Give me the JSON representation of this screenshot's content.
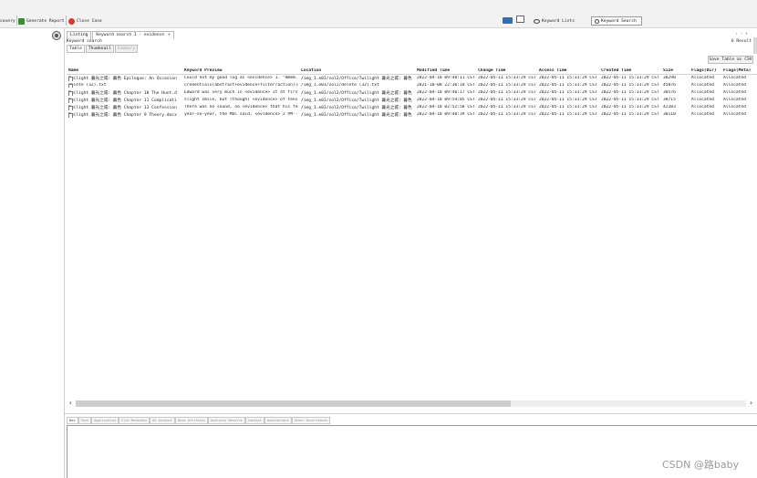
{
  "toolbar": {
    "discovery_label": "covery",
    "generate_report_label": "Generate Report",
    "close_case_label": "Close Case",
    "keyword_lists_label": "Keyword Lists",
    "keyword_search_label": "Keyword Search"
  },
  "results": {
    "tabs": [
      {
        "label": "Listing"
      },
      {
        "label": "Keyword search 1 - evidence",
        "close": "×"
      }
    ],
    "nav_arrows": "‹ › ▾",
    "keyword_label": "Keyword search",
    "result_count": "6 Result",
    "view_tabs": [
      "Table",
      "Thumbnail",
      "Summary"
    ],
    "save_button": "Save Table as CSV",
    "columns": [
      "Name",
      "Keyword Preview",
      "Location",
      "Modified Time",
      "Change Time",
      "Access Time",
      "Created Time",
      "Size",
      "Flags(Dir)",
      "Flags(Meta)"
    ],
    "rows": [
      [
        "Twilight 暮光之城: 暮色 Epilogue: An Occasion",
        "Could not my good log as <evidence> 1. \"Hmmm.\"",
        "/img_1.e01/vol2/Office/Twilight 暮光之城: 暮色",
        "2022-04-18 09:48:11 CST",
        "2022-05-11 15:33:29 CST",
        "2022-05-11 15:33:29 CST",
        "2022-05-11 15:33:29 CST",
        "38290",
        "Allocated",
        "Allocated"
      ],
      [
        "delete (32).txt",
        "credentials(abstract+evidence+filter/action)(mock",
        "/img_1.e01/vol2/delete (32).txt",
        "2021-10-08 22:36:18 CST",
        "2022-05-11 15:33:29 CST",
        "2022-05-11 15:33:29 CST",
        "2022-05-11 15:33:29 CST",
        "45076",
        "Allocated",
        "Allocated"
      ],
      [
        "Twilight 暮光之城: 暮色 Chapter 10 The Hunt.d",
        "Edward was very much in <evidence> It at first",
        "/img_1.e01/vol2/Office/Twilight 暮光之城: 暮色",
        "2022-04-18 09:46:17 CST",
        "2022-05-11 15:33:29 CST",
        "2022-05-11 15:33:29 CST",
        "2022-05-11 15:33:29 CST",
        "38576",
        "Allocated",
        "Allocated"
      ],
      [
        "Twilight 暮光之城: 暮色 Chapter 11 Complicati",
        "slight smile, but (though) <evidence> of tensio",
        "/img_1.e01/vol2/Office/Twilight 暮光之城: 暮色",
        "2022-04-18 09:54:05 CST",
        "2022-05-11 15:33:29 CST",
        "2022-05-11 15:33:29 CST",
        "2022-05-11 15:33:29 CST",
        "38715",
        "Allocated",
        "Allocated"
      ],
      [
        "Twilight 暮光之城: 暮色 Chapter 13 Confession",
        "There was no sound, no <evidence> that his fee",
        "/img_1.e01/vol2/Office/Twilight 暮光之城: 暮色",
        "2022-04-18 02:52:58 CST",
        "2022-05-11 15:33:29 CST",
        "2022-05-11 15:33:29 CST",
        "2022-05-11 15:33:29 CST",
        "42383",
        "Allocated",
        "Allocated"
      ],
      [
        "Twilight 暮光之城: 暮色 Chapter 9 Theory.docx",
        "year-so-year, the MOC said, <evidence> 2 PM--",
        "/img_1.e01/vol2/Office/Twilight 暮光之城: 暮色",
        "2022-04-18 09:48:39 CST",
        "2022-05-11 15:33:29 CST",
        "2022-05-11 15:33:29 CST",
        "2022-05-11 15:33:29 CST",
        "38110",
        "Allocated",
        "Allocated"
      ]
    ]
  },
  "viewer": {
    "tabs": [
      "Hex",
      "Text",
      "Application",
      "File Metadata",
      "OS Account",
      "Data Artifacts",
      "Analysis Results",
      "Context",
      "Annotations",
      "Other Occurrences"
    ]
  },
  "watermark": "CSDN @路baby"
}
